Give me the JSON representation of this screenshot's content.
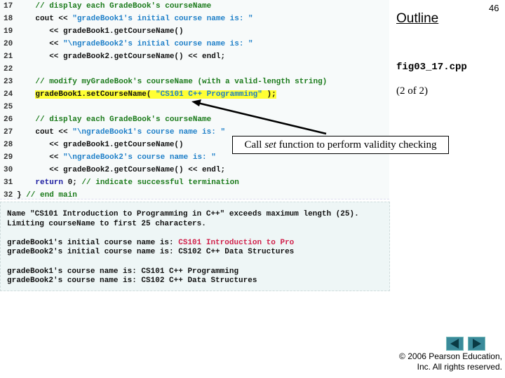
{
  "code_lines": [
    {
      "n": "17",
      "parts": [
        [
          "",
          "    "
        ],
        [
          "cm",
          "// display each GradeBook's courseName"
        ]
      ]
    },
    {
      "n": "18",
      "parts": [
        [
          "",
          "    cout << "
        ],
        [
          "st",
          "\"gradeBook1's initial course name is: \""
        ]
      ]
    },
    {
      "n": "19",
      "parts": [
        [
          "",
          "       << gradeBook1.getCourseName()"
        ]
      ]
    },
    {
      "n": "20",
      "parts": [
        [
          "",
          "       << "
        ],
        [
          "st",
          "\"\\ngradeBook2's initial course name is: \""
        ]
      ]
    },
    {
      "n": "21",
      "parts": [
        [
          "",
          "       << gradeBook2.getCourseName() << endl;"
        ]
      ]
    },
    {
      "n": "22",
      "parts": []
    },
    {
      "n": "23",
      "parts": [
        [
          "",
          "    "
        ],
        [
          "cm",
          "// modify myGradeBook's courseName (with a valid-length string)"
        ]
      ]
    },
    {
      "n": "24",
      "parts": [
        [
          "",
          "    "
        ],
        [
          "hl",
          "gradeBook1.setCourseName( "
        ],
        [
          "hl st",
          "\"CS101 C++ Programming\""
        ],
        [
          "hl",
          " );"
        ]
      ]
    },
    {
      "n": "25",
      "parts": []
    },
    {
      "n": "26",
      "parts": [
        [
          "",
          "    "
        ],
        [
          "cm",
          "// display each GradeBook's courseName"
        ]
      ]
    },
    {
      "n": "27",
      "parts": [
        [
          "",
          "    cout << "
        ],
        [
          "st",
          "\"\\ngradeBook1's course name is: \""
        ]
      ]
    },
    {
      "n": "28",
      "parts": [
        [
          "",
          "       << gradeBook1.getCourseName()"
        ]
      ]
    },
    {
      "n": "29",
      "parts": [
        [
          "",
          "       << "
        ],
        [
          "st",
          "\"\\ngradeBook2's course name is: \""
        ]
      ]
    },
    {
      "n": "30",
      "parts": [
        [
          "",
          "       << gradeBook2.getCourseName() << endl;"
        ]
      ]
    },
    {
      "n": "31",
      "parts": [
        [
          "",
          "    "
        ],
        [
          "kw",
          "return"
        ],
        [
          "",
          " 0; "
        ],
        [
          "cm",
          "// indicate successful termination"
        ]
      ]
    },
    {
      "n": "32",
      "parts": [
        [
          "",
          "} "
        ],
        [
          "cm",
          "// end main"
        ]
      ]
    }
  ],
  "output_lines": [
    [
      [
        "",
        "Name \"CS101 Introduction to Programming in C++\" exceeds maximum length (25)."
      ]
    ],
    [
      [
        "",
        "Limiting courseName to first 25 characters."
      ]
    ],
    [],
    [
      [
        "",
        "gradeBook1's initial course name is: "
      ],
      [
        "red",
        "CS101 Introduction to Pro"
      ]
    ],
    [
      [
        "",
        "gradeBook2's initial course name is: CS102 C++ Data Structures"
      ]
    ],
    [],
    [
      [
        "",
        "gradeBook1's course name is: CS101 C++ Programming"
      ]
    ],
    [
      [
        "",
        "gradeBook2's course name is: CS102 C++ Data Structures"
      ]
    ]
  ],
  "side": {
    "outline": "Outline",
    "page_number": "46",
    "filename": "fig03_17.cpp",
    "page_of": "(2 of 2)"
  },
  "callout": {
    "pre": "Call ",
    "em": "set",
    "post": " function to perform validity checking"
  },
  "nav": {
    "prev": "previous-slide",
    "next": "next-slide"
  },
  "copyright": {
    "line1": "© 2006 Pearson Education,",
    "line2": "Inc.  All rights reserved."
  }
}
